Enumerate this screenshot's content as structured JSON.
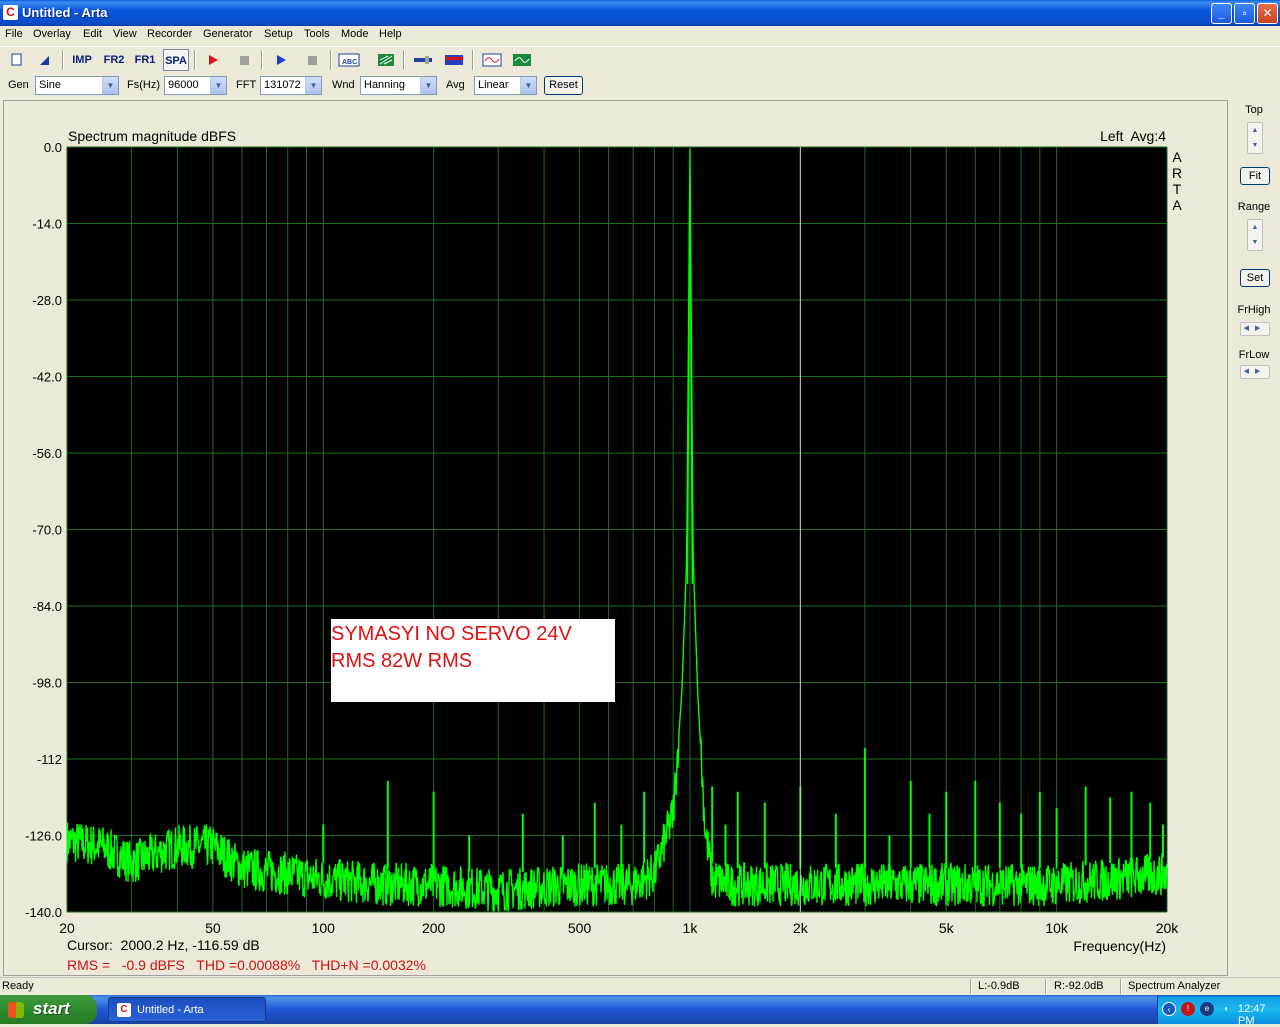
{
  "window": {
    "title": "Untitled - Arta",
    "icon": "C"
  },
  "menu": [
    "File",
    "Overlay",
    "Edit",
    "View",
    "Recorder",
    "Generator",
    "Setup",
    "Tools",
    "Mode",
    "Help"
  ],
  "toolbar": {
    "imp": "IMP",
    "fr2": "FR2",
    "fr1": "FR1",
    "spa": "SPA"
  },
  "settings": {
    "gen_label": "Gen",
    "gen_value": "Sine",
    "fs_label": "Fs(Hz)",
    "fs_value": "96000",
    "fft_label": "FFT",
    "fft_value": "131072",
    "wnd_label": "Wnd",
    "wnd_value": "Hanning",
    "avg_label": "Avg",
    "avg_value": "Linear",
    "reset": "Reset"
  },
  "side": {
    "top": "Top",
    "fit": "Fit",
    "range": "Range",
    "set": "Set",
    "frhigh": "FrHigh",
    "frlow": "FrLow"
  },
  "chart_data": {
    "type": "line",
    "title": "Spectrum magnitude dBFS",
    "channel_info": "Left  Avg:4",
    "watermark": "A\nR\nT\nA",
    "xlabel": "Frequency(Hz)",
    "x_scale": "log",
    "xlim": [
      20,
      20000
    ],
    "ylim": [
      -140,
      0
    ],
    "y_ticks": [
      "0.0",
      "-14.0",
      "-28.0",
      "-42.0",
      "-56.0",
      "-70.0",
      "-84.0",
      "-98.0",
      "-112",
      "-126.0",
      "-140.0"
    ],
    "y_tick_values": [
      0,
      -14,
      -28,
      -42,
      -56,
      -70,
      -84,
      -98,
      -112,
      -126,
      -140
    ],
    "x_ticks": [
      "20",
      "50",
      "100",
      "200",
      "500",
      "1k",
      "2k",
      "5k",
      "10k",
      "20k"
    ],
    "x_tick_values": [
      20,
      50,
      100,
      200,
      500,
      1000,
      2000,
      5000,
      10000,
      20000
    ],
    "cursor_frequency": 2000.2,
    "fundamental": {
      "x": 1000,
      "y": -0.3
    },
    "series": [
      {
        "color": "#00ff00",
        "noise_floor": [
          [
            20,
            -127
          ],
          [
            25,
            -128
          ],
          [
            30,
            -131
          ],
          [
            40,
            -128
          ],
          [
            50,
            -128
          ],
          [
            60,
            -132
          ],
          [
            80,
            -133
          ],
          [
            100,
            -134
          ],
          [
            150,
            -135
          ],
          [
            200,
            -135
          ],
          [
            300,
            -136
          ],
          [
            500,
            -135
          ],
          [
            700,
            -135
          ],
          [
            800,
            -133
          ],
          [
            900,
            -122
          ],
          [
            950,
            -100
          ],
          [
            980,
            -75
          ],
          [
            1000,
            -0.3
          ],
          [
            1020,
            -75
          ],
          [
            1050,
            -100
          ],
          [
            1100,
            -125
          ],
          [
            1150,
            -134
          ],
          [
            1300,
            -135
          ],
          [
            2000,
            -135
          ],
          [
            5000,
            -135
          ],
          [
            10000,
            -135
          ],
          [
            20000,
            -133
          ]
        ],
        "harmonic_spurs": [
          [
            100,
            -124
          ],
          [
            150,
            -116
          ],
          [
            200,
            -118
          ],
          [
            250,
            -126
          ],
          [
            350,
            -122
          ],
          [
            450,
            -126
          ],
          [
            550,
            -120
          ],
          [
            650,
            -124
          ],
          [
            750,
            -118
          ],
          [
            850,
            -124
          ],
          [
            1150,
            -117
          ],
          [
            1250,
            -124
          ],
          [
            1350,
            -118
          ],
          [
            1600,
            -120
          ],
          [
            2000,
            -117
          ],
          [
            2500,
            -122
          ],
          [
            3000,
            -110
          ],
          [
            3500,
            -126
          ],
          [
            4000,
            -116
          ],
          [
            4500,
            -122
          ],
          [
            5000,
            -118
          ],
          [
            6000,
            -116
          ],
          [
            7000,
            -120
          ],
          [
            8000,
            -122
          ],
          [
            9000,
            -118
          ],
          [
            10000,
            -121
          ],
          [
            12000,
            -117
          ],
          [
            14000,
            -119
          ],
          [
            16000,
            -118
          ],
          [
            18000,
            -120
          ],
          [
            19500,
            -124
          ]
        ]
      }
    ],
    "annotation": [
      "SYMASYI NO SERVO 24V",
      "RMS 82W RMS"
    ],
    "cursor_readout": "Cursor:  2000.2 Hz, -116.59 dB",
    "measurements": "RMS =   -0.9 dBFS   THD =0.00088%   THD+N =0.0032%"
  },
  "status": {
    "ready": "Ready",
    "left": "L:-0.9dB",
    "right": "R:-92.0dB",
    "mode": "Spectrum Analyzer"
  },
  "taskbar": {
    "start": "start",
    "item": "Untitled - Arta",
    "clock": "12:47 PM"
  }
}
